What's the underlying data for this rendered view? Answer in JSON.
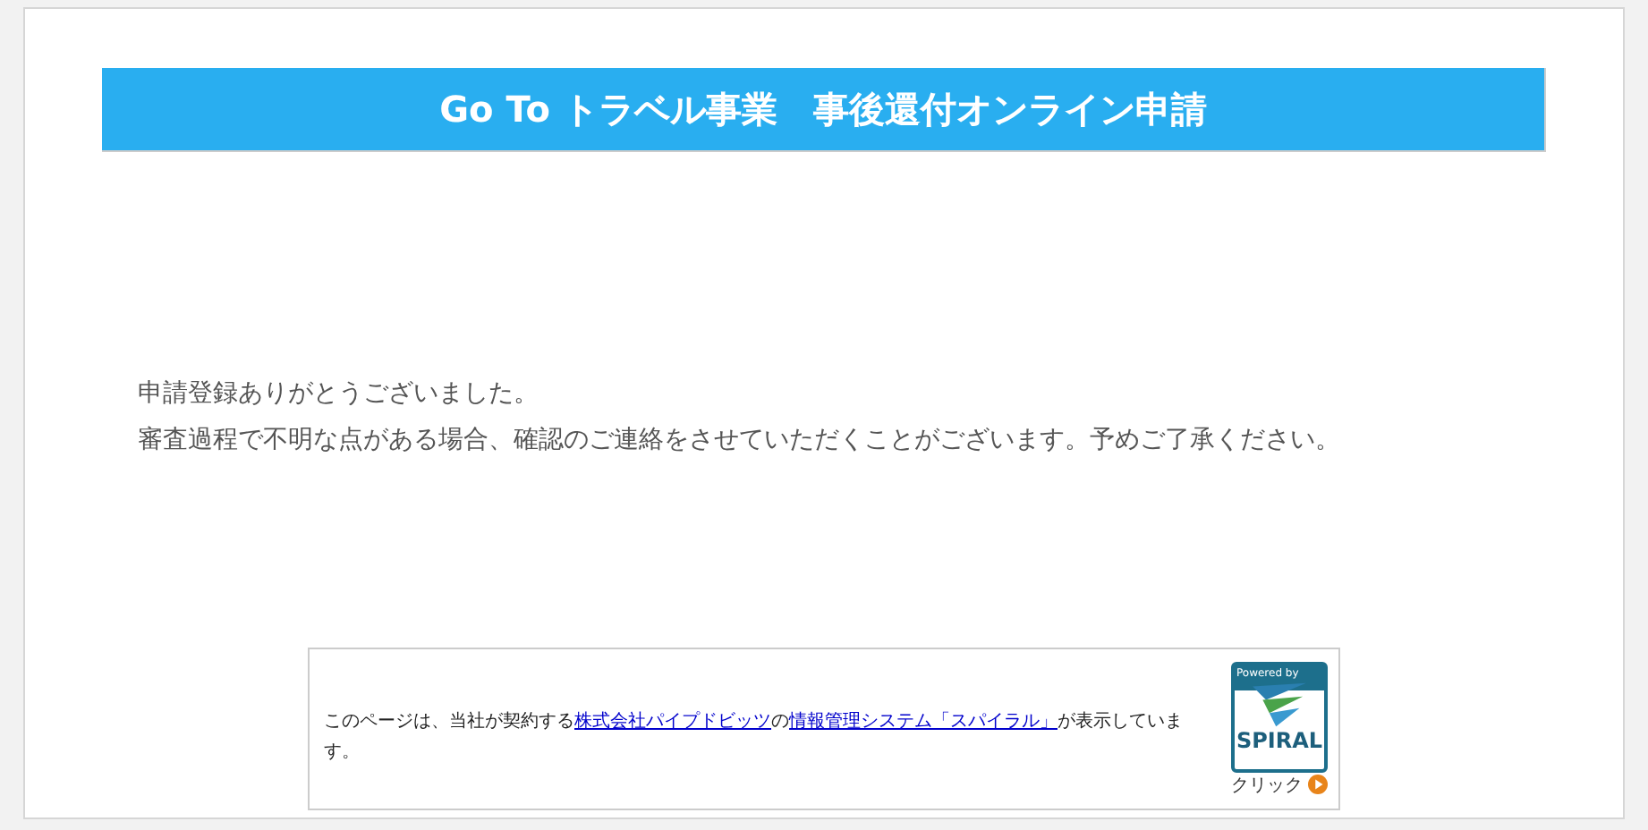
{
  "header": {
    "title": "Go To トラベル事業　事後還付オンライン申請"
  },
  "message": {
    "lines": [
      "申請登録ありがとうございました。",
      "審査過程で不明な点がある場合、確認のご連絡をさせていただくことがございます。予めご了承ください。"
    ]
  },
  "footer": {
    "parts": [
      {
        "kind": "text",
        "text": "このページは、当社が契約する"
      },
      {
        "kind": "link",
        "text": "株式会社パイプドビッツ"
      },
      {
        "kind": "text",
        "text": "の"
      },
      {
        "kind": "link",
        "text": "情報管理システム「スパイラル」"
      },
      {
        "kind": "text",
        "text": "が表示しています。"
      }
    ],
    "badge": {
      "powered": "Powered by",
      "brand": "SPIRAL",
      "click": "クリック"
    }
  }
}
